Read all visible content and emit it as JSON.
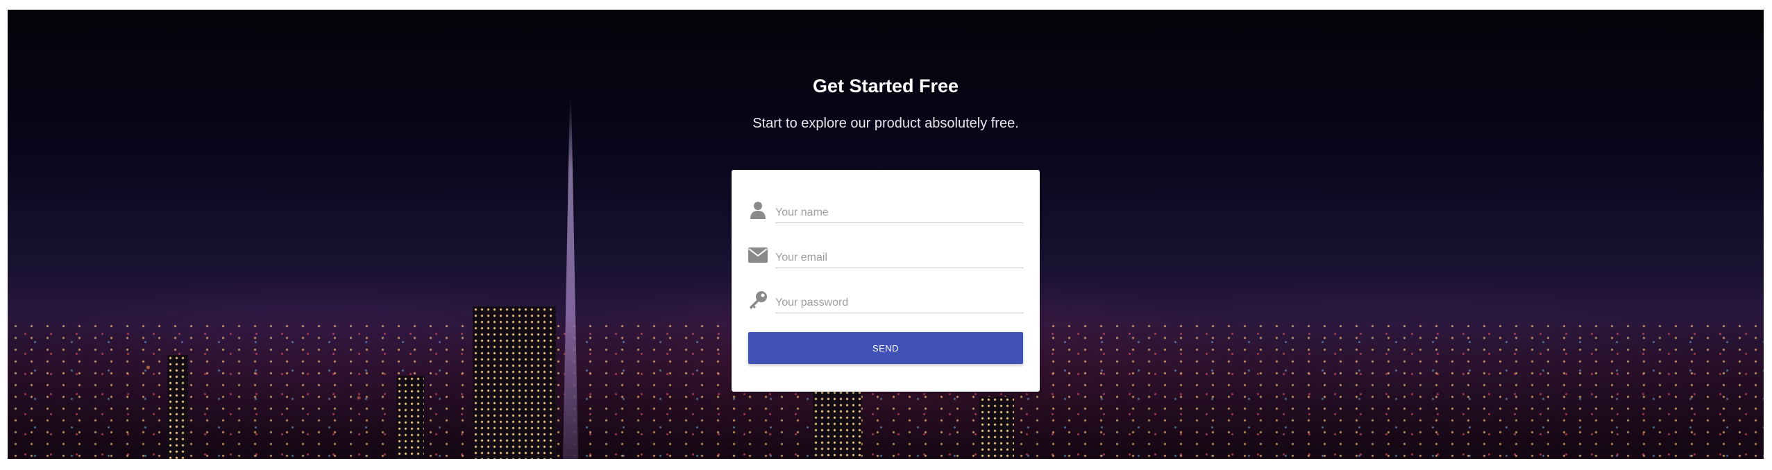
{
  "hero": {
    "title": "Get Started Free",
    "subtitle": "Start to explore our product absolutely free."
  },
  "form": {
    "name_placeholder": "Your name",
    "email_placeholder": "Your email",
    "password_placeholder": "Your password",
    "send_label": "SEND",
    "icons": {
      "name": "user-icon",
      "email": "envelope-icon",
      "password": "key-icon"
    }
  },
  "colors": {
    "button": "#3f51b5",
    "icon": "#8a8a8a"
  }
}
